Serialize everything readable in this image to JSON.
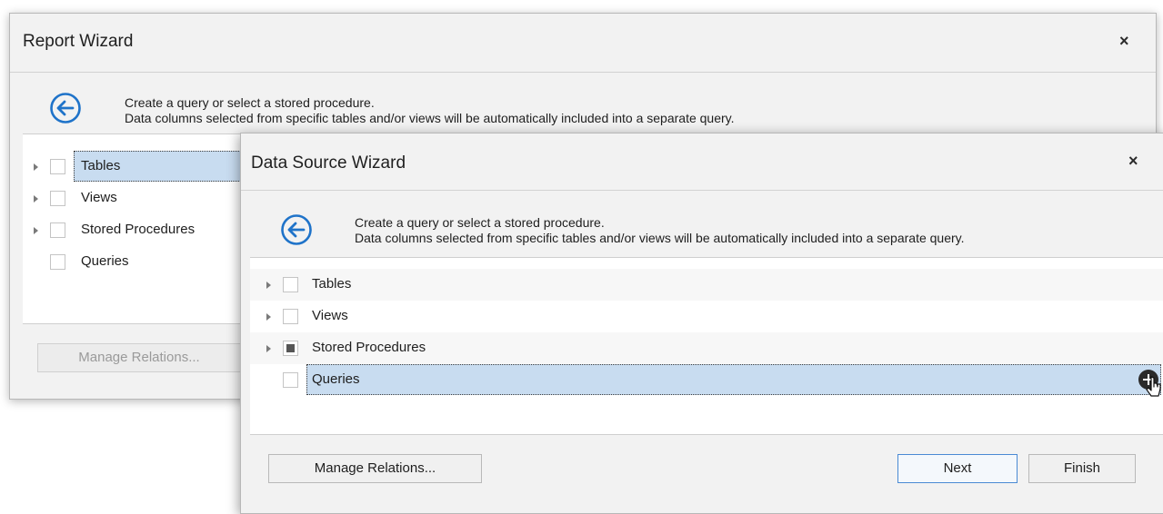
{
  "report_wizard": {
    "title": "Report Wizard",
    "close": "×",
    "header": {
      "line1": "Create a query or select a stored procedure.",
      "line2": "Data columns selected from specific tables and/or views will be automatically included into a separate query."
    },
    "tree": [
      {
        "label": "Tables",
        "has_children": true,
        "checked": "unchecked",
        "selected": true
      },
      {
        "label": "Views",
        "has_children": true,
        "checked": "unchecked"
      },
      {
        "label": "Stored Procedures",
        "has_children": true,
        "checked": "unchecked"
      },
      {
        "label": "Queries",
        "has_children": false,
        "checked": "unchecked"
      }
    ],
    "buttons": {
      "manage_relations": "Manage Relations..."
    }
  },
  "data_source_wizard": {
    "title": "Data Source Wizard",
    "close": "×",
    "header": {
      "line1": "Create a query or select a stored procedure.",
      "line2": "Data columns selected from specific tables and/or views will be automatically included into a separate query."
    },
    "tree": [
      {
        "label": "Tables",
        "has_children": true,
        "checked": "unchecked"
      },
      {
        "label": "Views",
        "has_children": true,
        "checked": "unchecked"
      },
      {
        "label": "Stored Procedures",
        "has_children": true,
        "checked": "indeterminate"
      },
      {
        "label": "Queries",
        "has_children": false,
        "checked": "unchecked",
        "selected": true
      }
    ],
    "buttons": {
      "manage_relations": "Manage Relations...",
      "next": "Next",
      "finish": "Finish"
    }
  },
  "colors": {
    "accent_blue": "#1f73c9",
    "selection": "#c8dcf0",
    "window_bg": "#f2f2f2"
  },
  "icons": [
    "back-arrow-icon",
    "close-icon",
    "expand-arrow-icon",
    "add-query-icon",
    "mouse-cursor-icon"
  ]
}
